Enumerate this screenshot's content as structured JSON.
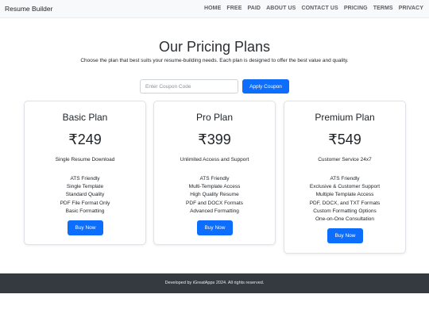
{
  "navbar": {
    "brand": "Resume Builder",
    "links": [
      "HOME",
      "FREE",
      "PAID",
      "ABOUT US",
      "CONTACT US",
      "PRICING",
      "TERMS",
      "PRIVACY"
    ]
  },
  "header": {
    "title": "Our Pricing Plans",
    "subtitle": "Choose the plan that best suits your resume-building needs. Each plan is designed to offer the best value and quality."
  },
  "coupon": {
    "placeholder": "Enter Coupon Code",
    "button_label": "Apply Coupon"
  },
  "plans": [
    {
      "name": "Basic Plan",
      "price": "₹249",
      "tagline": "Single Resume Download",
      "features": [
        "ATS Friendly",
        "Single Template",
        "Standard Quality",
        "PDF File Format Only",
        "Basic Formatting"
      ],
      "button_label": "Buy Now"
    },
    {
      "name": "Pro Plan",
      "price": "₹399",
      "tagline": "Unlimited Access and Support",
      "features": [
        "ATS Friendly",
        "Multi-Template Access",
        "High Quality Resume",
        "PDF and DOCX Formats",
        "Advanced Formatting"
      ],
      "button_label": "Buy Now"
    },
    {
      "name": "Premium Plan",
      "price": "₹549",
      "tagline": "Customer Service 24x7",
      "features": [
        "ATS Friendly",
        "Exclusive & Customer Support",
        "Multiple Template Access",
        "PDF, DOCX, and TXT Formats",
        "Custom Formatting Options",
        "One-on-One Consultation"
      ],
      "button_label": "Buy Now"
    }
  ],
  "footer": {
    "text": "Developed by iGreatApps 2024. All rights reserved."
  },
  "colors": {
    "primary": "#0d6efd",
    "navbar_bg": "#f8f9fa",
    "footer_bg": "#343a40"
  }
}
